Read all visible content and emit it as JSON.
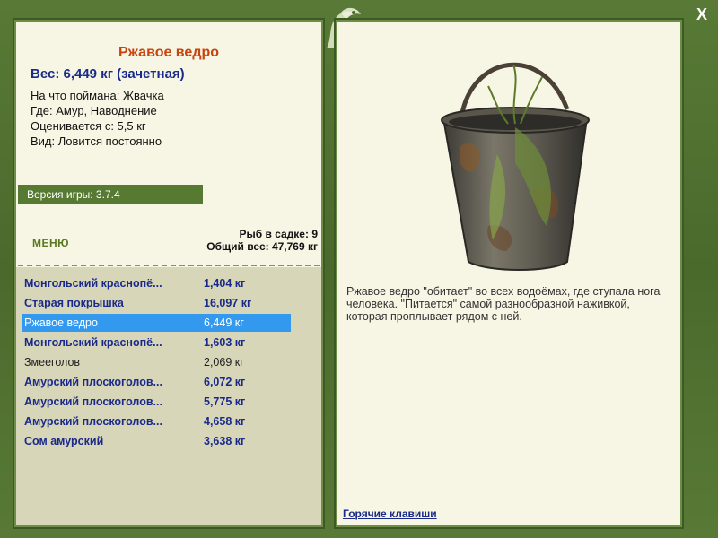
{
  "fish": {
    "title": "Ржавое ведро",
    "weight_line": "Вес: 6,449 кг (зачетная)",
    "caught_on": "На что поймана: Жвачка",
    "where": "Где: Амур, Наводнение",
    "valued_from": "Оценивается с: 5,5 кг",
    "kind": "Вид: Ловится постоянно",
    "description": "Ржавое ведро \"обитает\" во всех водоёмах, где ступала нога человека. \"Питается\" самой разнообразной наживкой, которая проплывает рядом с ней."
  },
  "version": "Версия игры: 3.7.4",
  "menu_label": "МЕНЮ",
  "keep": {
    "count_line": "Рыб в садке: 9",
    "total_line": "Общий вес: 47,769 кг"
  },
  "catch_list": [
    {
      "name": "Монгольский краснопё...",
      "weight": "1,404 кг",
      "style": "bold"
    },
    {
      "name": "Старая покрышка",
      "weight": "16,097 кг",
      "style": "bold"
    },
    {
      "name": "Ржавое ведро",
      "weight": "6,449 кг",
      "style": "selected"
    },
    {
      "name": "Монгольский краснопё...",
      "weight": "1,603 кг",
      "style": "bold"
    },
    {
      "name": "Змееголов",
      "weight": "2,069 кг",
      "style": "plain"
    },
    {
      "name": "Амурский плоскоголов...",
      "weight": "6,072 кг",
      "style": "bold"
    },
    {
      "name": "Амурский плоскоголов...",
      "weight": "5,775 кг",
      "style": "bold"
    },
    {
      "name": "Амурский плоскоголов...",
      "weight": "4,658 кг",
      "style": "bold"
    },
    {
      "name": "Сом амурский",
      "weight": "3,638 кг",
      "style": "bold"
    }
  ],
  "hotkeys_label": "Горячие клавиши",
  "close_label": "X",
  "icons": {
    "close": "close-icon",
    "emblem": "fish-emblem-icon",
    "item_image": "rusty-bucket-image"
  },
  "colors": {
    "frame": "#4c6a2e",
    "panel": "#f7f5e4",
    "title": "#c8440e",
    "text_blue": "#1a2a8a",
    "selected": "#3399ee"
  }
}
